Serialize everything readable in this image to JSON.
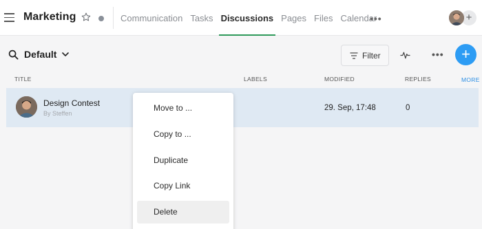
{
  "header": {
    "title": "Marketing",
    "tabs": [
      {
        "label": "Communication",
        "active": false
      },
      {
        "label": "Tasks",
        "active": false
      },
      {
        "label": "Discussions",
        "active": true
      },
      {
        "label": "Pages",
        "active": false
      },
      {
        "label": "Files",
        "active": false
      },
      {
        "label": "Calendar",
        "active": false
      }
    ],
    "more_label": "•••",
    "add_user_label": "+",
    "accent_color": "#2e9a5a"
  },
  "toolbar": {
    "filter_name": "Default",
    "filter_button_label": "Filter",
    "more_label": "•••",
    "add_label": "+",
    "add_color": "#2d9cf4"
  },
  "table": {
    "columns": {
      "title": "TITLE",
      "labels": "LABELS",
      "modified": "MODIFIED",
      "replies": "REPLIES",
      "more": "MORE"
    },
    "rows": [
      {
        "title": "Design Contest",
        "author": "By Steffen",
        "modified": "29. Sep, 17:48",
        "replies": "0"
      }
    ],
    "selected_row_color": "#dfe9f3"
  },
  "context_menu": {
    "items": [
      {
        "label": "Move to ..."
      },
      {
        "label": "Copy to ..."
      },
      {
        "label": "Duplicate"
      },
      {
        "label": "Copy Link"
      },
      {
        "label": "Delete",
        "hovered": true
      }
    ]
  }
}
